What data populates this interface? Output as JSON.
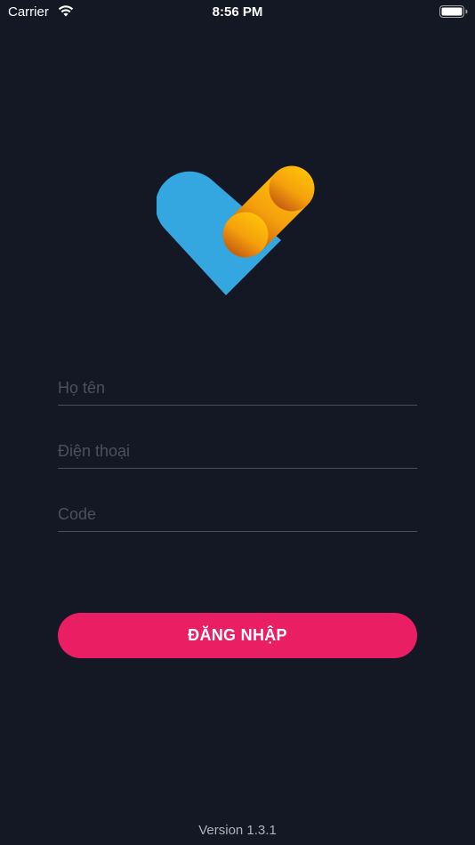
{
  "status_bar": {
    "carrier": "Carrier",
    "time": "8:56 PM",
    "wifi_icon": "wifi-icon",
    "battery_icon": "battery-icon"
  },
  "logo": {
    "icon": "checkmark-heart-logo",
    "colors": {
      "blue": "#34a6e0",
      "orange_light": "#ffc107",
      "orange_dark": "#d46a0e"
    }
  },
  "form": {
    "name": {
      "placeholder": "Họ tên",
      "value": ""
    },
    "phone": {
      "placeholder": "Điện thoại",
      "value": ""
    },
    "code": {
      "placeholder": "Code",
      "value": ""
    }
  },
  "login_button": {
    "label": "ĐĂNG NHẬP",
    "color": "#e91e63"
  },
  "footer": {
    "version": "Version 1.3.1"
  },
  "theme": {
    "background": "#141824"
  }
}
